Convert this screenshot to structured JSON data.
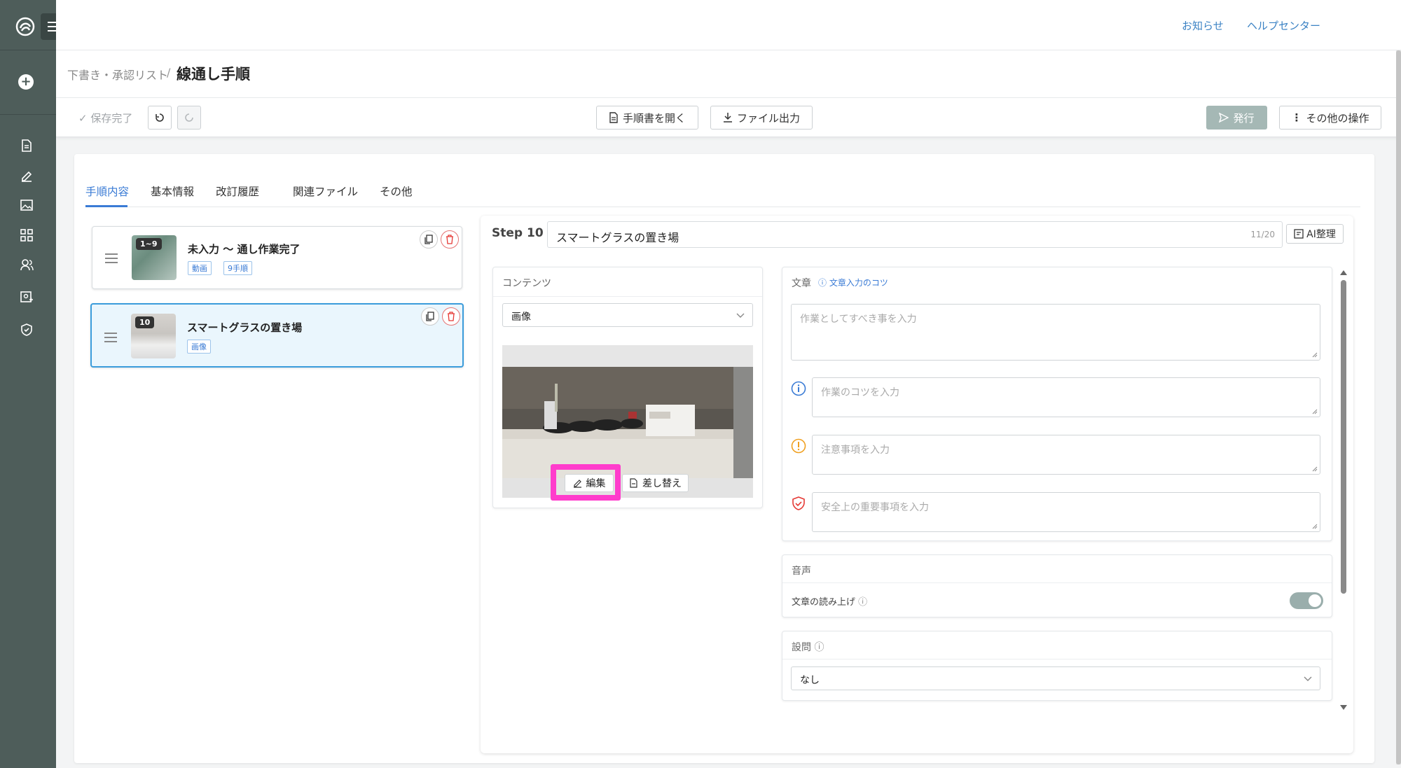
{
  "header": {
    "news_link": "お知らせ",
    "help_link": "ヘルプセンター"
  },
  "breadcrumb": {
    "parent": "下書き・承認リスト",
    "separator": "/",
    "current": "線通し手順"
  },
  "toolbar": {
    "save_status": "保存完了",
    "open_manual": "手順書を開く",
    "file_export": "ファイル出力",
    "publish": "発行",
    "other_actions": "その他の操作"
  },
  "tabs": [
    {
      "label": "手順内容",
      "active": true
    },
    {
      "label": "基本情報",
      "active": false
    },
    {
      "label": "改訂履歴",
      "active": false
    },
    {
      "label": "関連ファイル",
      "active": false
    },
    {
      "label": "その他",
      "active": false
    }
  ],
  "steps": [
    {
      "badge": "1~9",
      "title": "未入力 〜 通し作業完了",
      "tags": [
        "動画",
        "9手順"
      ],
      "active": false
    },
    {
      "badge": "10",
      "title": "スマートグラスの置き場",
      "tags": [
        "画像"
      ],
      "active": true
    }
  ],
  "editor": {
    "step_label": "Step 10",
    "title_value": "スマートグラスの置き場",
    "title_count": "11/20",
    "ai_button": "AI整理",
    "content": {
      "label": "コンテンツ",
      "type_value": "画像",
      "edit_button": "編集",
      "replace_button": "差し替え"
    },
    "text": {
      "label": "文章",
      "tips_link": "文章入力のコツ",
      "main_placeholder": "作業としてすべき事を入力",
      "tip_placeholder": "作業のコツを入力",
      "caution_placeholder": "注意事項を入力",
      "safety_placeholder": "安全上の重要事項を入力"
    },
    "audio": {
      "label": "音声",
      "read_aloud_label": "文章の読み上げ",
      "read_aloud_on": true
    },
    "question": {
      "label": "設問",
      "value": "なし"
    }
  },
  "colors": {
    "accent": "#3a7bd5",
    "sidebar": "#4e5d5a",
    "highlight": "#ff3ccc"
  }
}
